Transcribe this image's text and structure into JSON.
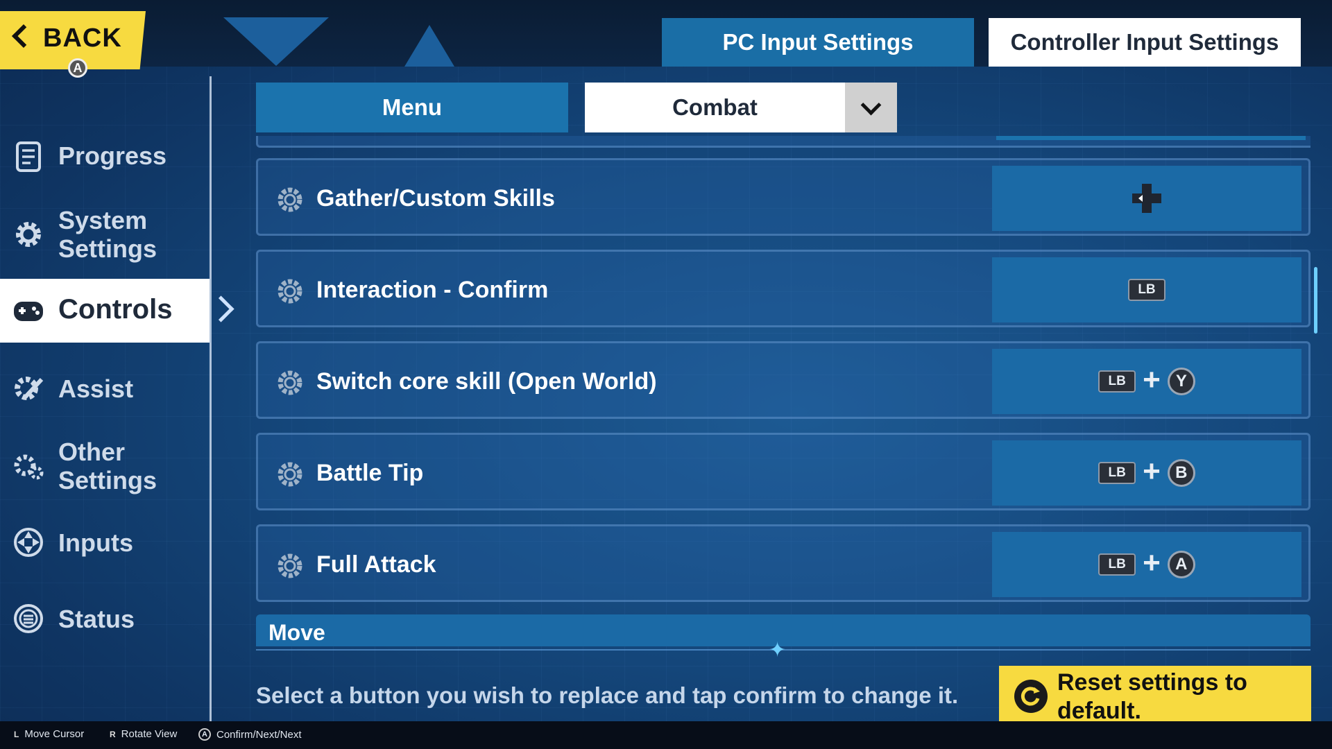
{
  "header": {
    "back_label": "BACK",
    "back_badge": "A",
    "tabs": [
      {
        "label": "PC Input Settings",
        "active": true
      },
      {
        "label": "Controller Input Settings",
        "active": false
      }
    ]
  },
  "sidebar": {
    "items": [
      {
        "label": "Progress",
        "icon": "document-icon"
      },
      {
        "label": "System\nSettings",
        "icon": "gear-icon"
      },
      {
        "label": "Controls",
        "icon": "gamepad-icon",
        "active": true
      },
      {
        "label": "Assist",
        "icon": "gear-wrench-icon"
      },
      {
        "label": "Other\nSettings",
        "icon": "gears-icon"
      },
      {
        "label": "Inputs",
        "icon": "dpad-icon"
      },
      {
        "label": "Status",
        "icon": "list-circle-icon"
      }
    ]
  },
  "subtabs": {
    "menu_label": "Menu",
    "combat_label": "Combat"
  },
  "bindings": [
    {
      "action": "Gather/Custom Skills",
      "keys": {
        "type": "dpad-left"
      }
    },
    {
      "action": "Interaction - Confirm",
      "keys": {
        "first": "LB"
      }
    },
    {
      "action": "Switch core skill (Open World)",
      "keys": {
        "first": "LB",
        "plus": "+",
        "second": "Y"
      }
    },
    {
      "action": "Battle Tip",
      "keys": {
        "first": "LB",
        "plus": "+",
        "second": "B"
      }
    },
    {
      "action": "Full Attack",
      "keys": {
        "first": "LB",
        "plus": "+",
        "second": "A"
      }
    }
  ],
  "section_header": "Move",
  "hint": "Select a button you wish to replace and tap confirm to change it.",
  "reset_label": "Reset settings to default.",
  "footer": [
    {
      "key": "L",
      "label": "Move Cursor"
    },
    {
      "key": "R",
      "label": "Rotate View"
    },
    {
      "key": "A",
      "label": "Confirm/Next/Next"
    }
  ],
  "colors": {
    "accent_yellow": "#f7da40",
    "tab_blue": "#1b73ad",
    "background": "#14467a",
    "scroll_indicator": "#6ed0ff"
  }
}
